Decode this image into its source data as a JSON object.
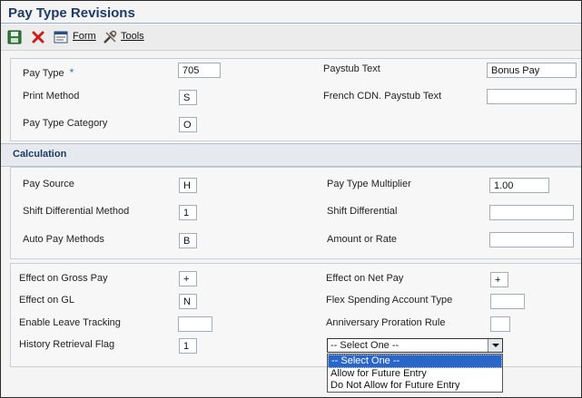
{
  "window": {
    "title": "Pay Type Revisions"
  },
  "toolbar": {
    "save_icon": "save-icon",
    "cancel_icon": "close-icon",
    "form_label": "Form",
    "tools_label": "Tools"
  },
  "general": {
    "pay_type": {
      "label": "Pay Type",
      "value": "705",
      "required_marker": "*"
    },
    "print_method": {
      "label": "Print Method",
      "value": "S"
    },
    "pay_type_category": {
      "label": "Pay Type Category",
      "value": "O"
    },
    "paystub_text": {
      "label": "Paystub Text",
      "value": "Bonus Pay"
    },
    "french_cdn_paystub_text": {
      "label": "French CDN. Paystub Text",
      "value": ""
    }
  },
  "calculation": {
    "heading": "Calculation",
    "pay_source": {
      "label": "Pay Source",
      "value": "H"
    },
    "shift_differential_method": {
      "label": "Shift Differential Method",
      "value": "1"
    },
    "auto_pay_methods": {
      "label": "Auto Pay Methods",
      "value": "B"
    },
    "pay_type_multiplier": {
      "label": "Pay Type Multiplier",
      "value": "1.00"
    },
    "shift_differential": {
      "label": "Shift Differential",
      "value": ""
    },
    "amount_or_rate": {
      "label": "Amount or Rate",
      "value": ""
    }
  },
  "effects": {
    "effect_on_gross_pay": {
      "label": "Effect on Gross Pay",
      "value": "+"
    },
    "effect_on_gl": {
      "label": "Effect on GL",
      "value": "N"
    },
    "enable_leave_tracking": {
      "label": "Enable Leave Tracking",
      "value": ""
    },
    "history_retrieval_flag": {
      "label": "History Retrieval Flag",
      "value": "1"
    },
    "effect_on_net_pay": {
      "label": "Effect on Net Pay",
      "value": "+"
    },
    "flex_spending_account_type": {
      "label": "Flex Spending Account Type",
      "value": ""
    },
    "anniversary_proration_rule": {
      "label": "Anniversary Proration Rule",
      "value": ""
    },
    "dropdown": {
      "selected": "-- Select One --",
      "options": [
        "-- Select One --",
        "Allow for Future Entry",
        "Do Not Allow for Future Entry"
      ]
    }
  },
  "colors": {
    "title": "#1d3b66",
    "highlight": "#2a66c8"
  }
}
